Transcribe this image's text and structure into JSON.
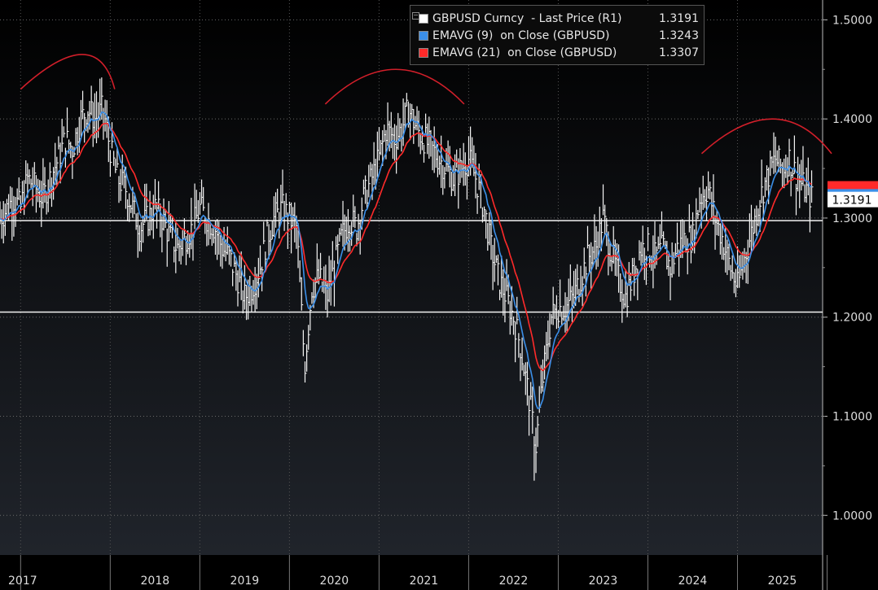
{
  "chart_data": {
    "type": "line",
    "ticker": "GBPUSD Curncy",
    "y_axis": {
      "position": "right",
      "ylim": [
        0.96,
        1.52
      ],
      "ticks": [
        "1.5000",
        "1.4000",
        "1.3000",
        "1.2000",
        "1.1000",
        "1.0000"
      ]
    },
    "x_axis": {
      "xlim": [
        2016.77,
        2025.95
      ],
      "year_labels": [
        "2017",
        "2018",
        "2019",
        "2020",
        "2021",
        "2022",
        "2023",
        "2024",
        "2025"
      ]
    },
    "legend": [
      {
        "label": "GBPUSD Curncy  - Last Price (R1)",
        "value": "1.3191",
        "color": "#ffffff"
      },
      {
        "label": "EMAVG (9)  on Close (GBPUSD)",
        "value": "1.3243",
        "color": "#3b8fe8"
      },
      {
        "label": "EMAVG (21)  on Close (GBPUSD)",
        "value": "1.3307",
        "color": "#ff2a2a"
      }
    ],
    "last_price_label": "1.3191",
    "horizontal_lines": [
      1.2974,
      1.2051
    ],
    "series": [
      {
        "name": "GBPUSD Curncy  - Last Price (R1)",
        "points": [
          [
            2016.77,
            1.3
          ],
          [
            2016.85,
            1.31
          ],
          [
            2016.92,
            1.32
          ],
          [
            2017.0,
            1.31
          ],
          [
            2017.08,
            1.34
          ],
          [
            2017.17,
            1.33
          ],
          [
            2017.25,
            1.32
          ],
          [
            2017.33,
            1.34
          ],
          [
            2017.42,
            1.36
          ],
          [
            2017.5,
            1.38
          ],
          [
            2017.58,
            1.37
          ],
          [
            2017.67,
            1.4
          ],
          [
            2017.75,
            1.41
          ],
          [
            2017.83,
            1.4
          ],
          [
            2017.92,
            1.41
          ],
          [
            2018.0,
            1.37
          ],
          [
            2018.08,
            1.34
          ],
          [
            2018.17,
            1.33
          ],
          [
            2018.25,
            1.31
          ],
          [
            2018.33,
            1.29
          ],
          [
            2018.42,
            1.3
          ],
          [
            2018.5,
            1.31
          ],
          [
            2018.58,
            1.3
          ],
          [
            2018.67,
            1.28
          ],
          [
            2018.75,
            1.27
          ],
          [
            2018.83,
            1.28
          ],
          [
            2018.92,
            1.29
          ],
          [
            2019.0,
            1.31
          ],
          [
            2019.08,
            1.3
          ],
          [
            2019.17,
            1.29
          ],
          [
            2019.25,
            1.27
          ],
          [
            2019.33,
            1.26
          ],
          [
            2019.42,
            1.24
          ],
          [
            2019.5,
            1.22
          ],
          [
            2019.58,
            1.23
          ],
          [
            2019.67,
            1.25
          ],
          [
            2019.75,
            1.28
          ],
          [
            2019.83,
            1.3
          ],
          [
            2019.92,
            1.31
          ],
          [
            2020.0,
            1.3
          ],
          [
            2020.08,
            1.29
          ],
          [
            2020.17,
            1.15
          ],
          [
            2020.25,
            1.23
          ],
          [
            2020.33,
            1.24
          ],
          [
            2020.42,
            1.22
          ],
          [
            2020.5,
            1.25
          ],
          [
            2020.58,
            1.28
          ],
          [
            2020.67,
            1.3
          ],
          [
            2020.75,
            1.29
          ],
          [
            2020.83,
            1.32
          ],
          [
            2020.92,
            1.34
          ],
          [
            2021.0,
            1.36
          ],
          [
            2021.08,
            1.39
          ],
          [
            2021.17,
            1.38
          ],
          [
            2021.25,
            1.39
          ],
          [
            2021.33,
            1.41
          ],
          [
            2021.42,
            1.39
          ],
          [
            2021.5,
            1.38
          ],
          [
            2021.58,
            1.37
          ],
          [
            2021.67,
            1.36
          ],
          [
            2021.75,
            1.35
          ],
          [
            2021.83,
            1.34
          ],
          [
            2021.92,
            1.35
          ],
          [
            2022.0,
            1.36
          ],
          [
            2022.08,
            1.34
          ],
          [
            2022.17,
            1.31
          ],
          [
            2022.25,
            1.27
          ],
          [
            2022.33,
            1.24
          ],
          [
            2022.42,
            1.22
          ],
          [
            2022.5,
            1.2
          ],
          [
            2022.58,
            1.17
          ],
          [
            2022.67,
            1.12
          ],
          [
            2022.75,
            1.07
          ],
          [
            2022.83,
            1.14
          ],
          [
            2022.92,
            1.2
          ],
          [
            2023.0,
            1.21
          ],
          [
            2023.08,
            1.21
          ],
          [
            2023.17,
            1.22
          ],
          [
            2023.25,
            1.24
          ],
          [
            2023.33,
            1.26
          ],
          [
            2023.42,
            1.27
          ],
          [
            2023.5,
            1.3
          ],
          [
            2023.58,
            1.27
          ],
          [
            2023.67,
            1.24
          ],
          [
            2023.75,
            1.22
          ],
          [
            2023.83,
            1.24
          ],
          [
            2023.92,
            1.27
          ],
          [
            2024.0,
            1.27
          ],
          [
            2024.08,
            1.26
          ],
          [
            2024.17,
            1.27
          ],
          [
            2024.25,
            1.25
          ],
          [
            2024.33,
            1.27
          ],
          [
            2024.42,
            1.28
          ],
          [
            2024.5,
            1.28
          ],
          [
            2024.58,
            1.32
          ],
          [
            2024.67,
            1.33
          ],
          [
            2024.75,
            1.3
          ],
          [
            2024.83,
            1.28
          ],
          [
            2024.92,
            1.25
          ],
          [
            2025.0,
            1.23
          ],
          [
            2025.08,
            1.26
          ],
          [
            2025.17,
            1.29
          ],
          [
            2025.25,
            1.32
          ],
          [
            2025.33,
            1.34
          ],
          [
            2025.42,
            1.36
          ],
          [
            2025.5,
            1.35
          ],
          [
            2025.58,
            1.36
          ],
          [
            2025.67,
            1.34
          ],
          [
            2025.75,
            1.33
          ],
          [
            2025.83,
            1.32
          ]
        ]
      }
    ]
  }
}
